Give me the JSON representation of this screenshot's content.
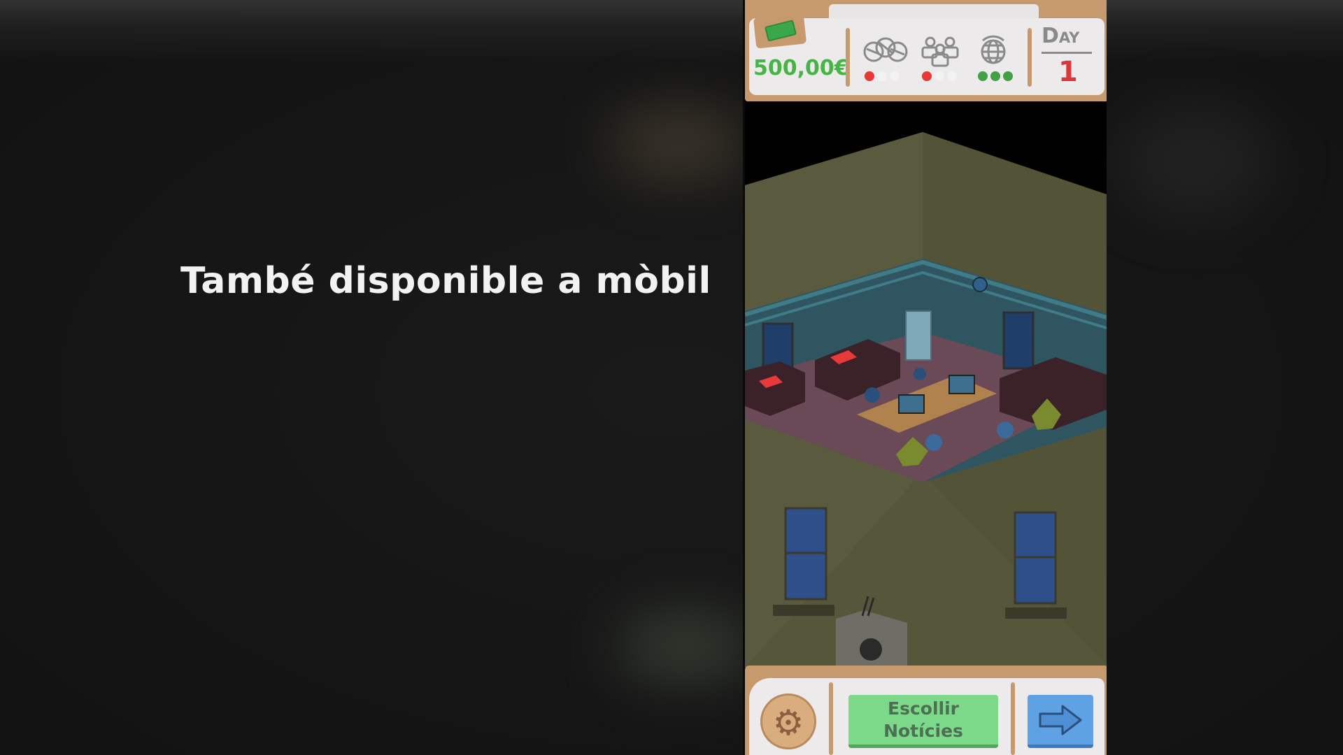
{
  "caption": "També disponible a mòbil",
  "hud": {
    "money": "500,00€",
    "day_label": "Day",
    "day_value": "1",
    "stats": [
      {
        "icon": "sports-balls-icon",
        "dots": [
          "#e53935",
          "#f2f2f2",
          "#f2f2f2"
        ]
      },
      {
        "icon": "people-icon",
        "dots": [
          "#e53935",
          "#f2f2f2",
          "#f2f2f2"
        ]
      },
      {
        "icon": "globe-icon",
        "dots": [
          "#43a047",
          "#43a047",
          "#43a047"
        ]
      }
    ]
  },
  "bottom_bar": {
    "news_button_label": "Escollir\nNotícies",
    "settings_icon": "gear-icon",
    "next_icon": "arrow-right-icon"
  },
  "colors": {
    "wood": "#c79a6e",
    "panel": "#eceaea",
    "money_green": "#47b447",
    "day_red": "#d9363e",
    "news_green": "#7cd98a",
    "next_blue": "#5fa2e4"
  }
}
